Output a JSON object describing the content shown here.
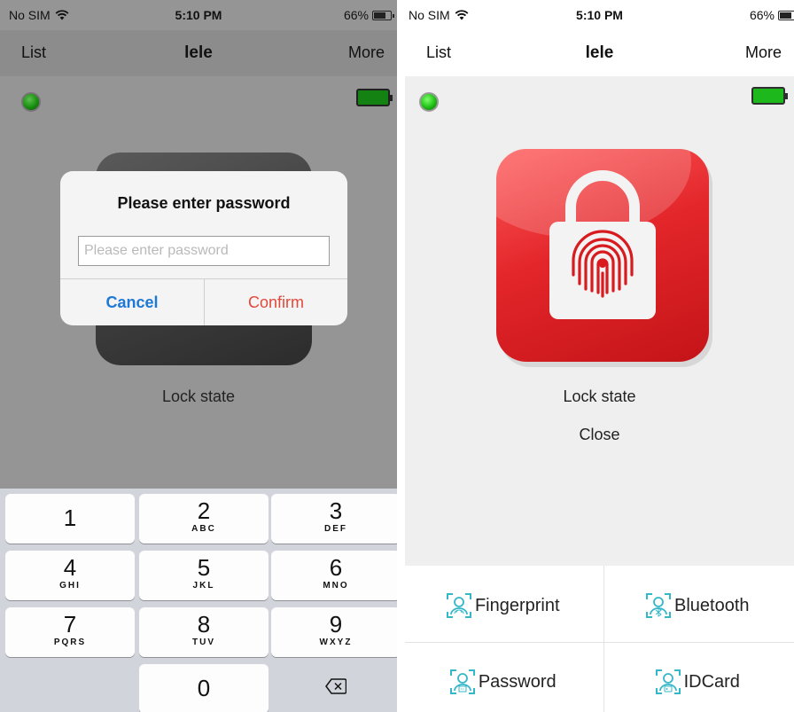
{
  "left": {
    "status": {
      "carrier": "No SIM",
      "time": "5:10 PM",
      "battery": "66%"
    },
    "nav": {
      "left": "List",
      "title": "lele",
      "right": "More"
    },
    "lock_state_label": "Lock state",
    "alert": {
      "title": "Please enter password",
      "placeholder": "Please enter password",
      "value": "",
      "cancel": "Cancel",
      "confirm": "Confirm"
    },
    "keypad": {
      "keys": [
        {
          "num": "1",
          "letters": ""
        },
        {
          "num": "2",
          "letters": "ABC"
        },
        {
          "num": "3",
          "letters": "DEF"
        },
        {
          "num": "4",
          "letters": "GHI"
        },
        {
          "num": "5",
          "letters": "JKL"
        },
        {
          "num": "6",
          "letters": "MNO"
        },
        {
          "num": "7",
          "letters": "PQRS"
        },
        {
          "num": "8",
          "letters": "TUV"
        },
        {
          "num": "9",
          "letters": "WXYZ"
        },
        {
          "num": "0",
          "letters": ""
        }
      ],
      "delete_icon": "backspace-icon"
    }
  },
  "right": {
    "status": {
      "carrier": "No SIM",
      "time": "5:10 PM",
      "battery": "66%"
    },
    "nav": {
      "left": "List",
      "title": "lele",
      "right": "More"
    },
    "lock_state_label": "Lock state",
    "lock_state_value": "Close",
    "methods": [
      "Fingerprint",
      "Bluetooth",
      "Password",
      "IDCard"
    ]
  },
  "colors": {
    "connected_led": "#1fbf15",
    "battery": "#1db81b",
    "lock_icon": "#e3262a",
    "cancel": "#1e78d6",
    "confirm": "#e2483b",
    "method_icon": "#34b7c9"
  }
}
